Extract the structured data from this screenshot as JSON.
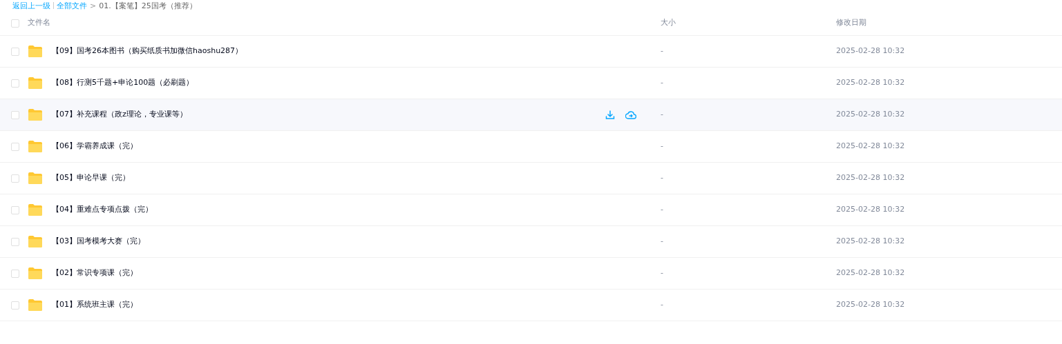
{
  "breadcrumb": {
    "back": "返回上一级",
    "root": "全部文件",
    "separator": ">",
    "current": "01.【案笔】25国考（推荐）"
  },
  "table": {
    "select_all_checked": false,
    "columns": [
      "文件名",
      "大小",
      "修改日期"
    ],
    "rows": [
      {
        "name": "【09】国考26本图书（购买纸质书加微信haoshu287）",
        "size": "-",
        "date": "2025-02-28 10:32",
        "checked": false,
        "hovered": false
      },
      {
        "name": "【08】行测5千题+申论100题（必刷题）",
        "size": "-",
        "date": "2025-02-28 10:32",
        "checked": false,
        "hovered": false
      },
      {
        "name": "【07】补充课程（政z理论，专业课等）",
        "size": "-",
        "date": "2025-02-28 10:32",
        "checked": false,
        "hovered": true
      },
      {
        "name": "【06】学霸养成课（完）",
        "size": "-",
        "date": "2025-02-28 10:32",
        "checked": false,
        "hovered": false
      },
      {
        "name": "【05】申论早课（完）",
        "size": "-",
        "date": "2025-02-28 10:32",
        "checked": false,
        "hovered": false
      },
      {
        "name": "【04】重难点专项点拨（完）",
        "size": "-",
        "date": "2025-02-28 10:32",
        "checked": false,
        "hovered": false
      },
      {
        "name": "【03】国考模考大赛（完）",
        "size": "-",
        "date": "2025-02-28 10:32",
        "checked": false,
        "hovered": false
      },
      {
        "name": "【02】常识专项课（完）",
        "size": "-",
        "date": "2025-02-28 10:32",
        "checked": false,
        "hovered": false
      },
      {
        "name": "【01】系统班主课（完）",
        "size": "-",
        "date": "2025-02-28 10:32",
        "checked": false,
        "hovered": false
      }
    ]
  }
}
